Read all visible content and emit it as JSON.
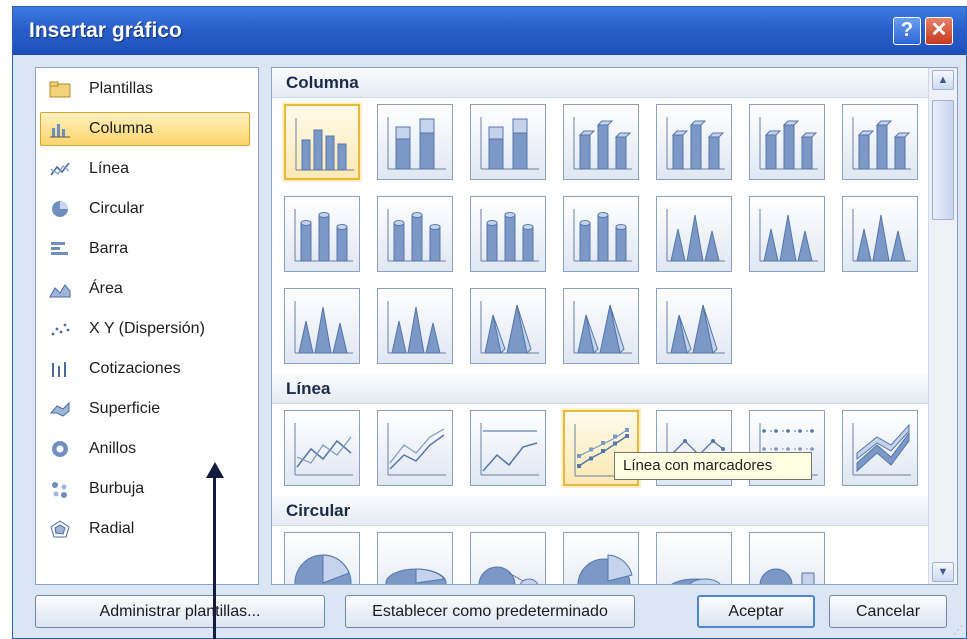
{
  "window": {
    "title": "Insertar gráfico",
    "help_glyph": "?",
    "close_glyph": "✕"
  },
  "categories": [
    {
      "label": "Plantillas",
      "icon": "folder-icon",
      "selected": false
    },
    {
      "label": "Columna",
      "icon": "column-chart-icon",
      "selected": true
    },
    {
      "label": "Línea",
      "icon": "line-chart-icon",
      "selected": false
    },
    {
      "label": "Circular",
      "icon": "pie-chart-icon",
      "selected": false
    },
    {
      "label": "Barra",
      "icon": "bar-chart-icon",
      "selected": false
    },
    {
      "label": "Área",
      "icon": "area-chart-icon",
      "selected": false
    },
    {
      "label": "X Y (Dispersión)",
      "icon": "scatter-chart-icon",
      "selected": false
    },
    {
      "label": "Cotizaciones",
      "icon": "stock-chart-icon",
      "selected": false
    },
    {
      "label": "Superficie",
      "icon": "surface-chart-icon",
      "selected": false
    },
    {
      "label": "Anillos",
      "icon": "doughnut-chart-icon",
      "selected": false
    },
    {
      "label": "Burbuja",
      "icon": "bubble-chart-icon",
      "selected": false
    },
    {
      "label": "Radial",
      "icon": "radar-chart-icon",
      "selected": false
    }
  ],
  "sections": [
    {
      "title": "Columna"
    },
    {
      "title": "Línea"
    },
    {
      "title": "Circular"
    }
  ],
  "tooltip": "Línea con marcadores",
  "buttons": {
    "manage_templates": "Administrar plantillas...",
    "set_default": "Establecer como predeterminado",
    "accept": "Aceptar",
    "cancel": "Cancelar"
  },
  "scrollbar": {
    "up_glyph": "▲",
    "down_glyph": "▼"
  },
  "colors": {
    "title_bar": "#2a5fcb",
    "selection": "#fcd56c",
    "chart_blue": "#6f8fbf"
  }
}
